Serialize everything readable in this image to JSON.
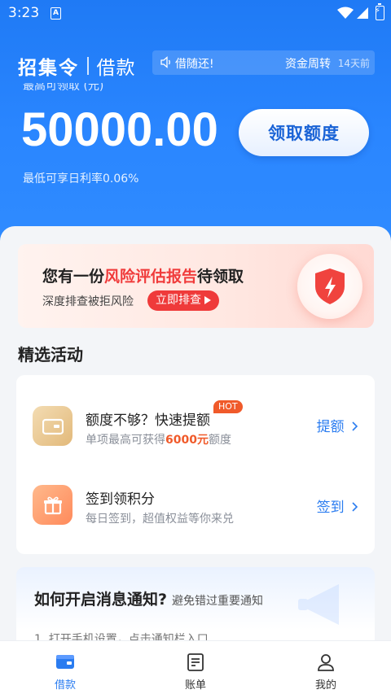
{
  "status_bar": {
    "time": "3:23",
    "app_indicator": "A"
  },
  "header": {
    "brand": "招集令",
    "section": "借款",
    "notice_left": "借随还!",
    "notice_mid": "资金周转",
    "notice_time": "14天前"
  },
  "loan": {
    "max_label": "最高可领取 (元)",
    "amount": "50000.00",
    "claim_button": "领取额度",
    "rate_text": "最低可享日利率0.06%"
  },
  "report_banner": {
    "title_prefix": "您有一份",
    "title_highlight": "风险评估报告",
    "title_suffix": "待领取",
    "subtitle": "深度排查被拒风险",
    "button": "立即排查"
  },
  "activities": {
    "title": "精选活动",
    "items": [
      {
        "name": "额度不够？快速提额",
        "badge": "HOT",
        "desc_prefix": "单项最高可获得",
        "desc_highlight": "6000元",
        "desc_suffix": "额度",
        "link": "提额",
        "icon": "wallet-card-icon"
      },
      {
        "name": "签到领积分",
        "desc": "每日签到，超值权益等你来兑",
        "link": "签到",
        "icon": "gift-icon"
      }
    ]
  },
  "notify_card": {
    "title": "如何开启消息通知?",
    "subtitle": "避免错过重要通知",
    "step": "1. 打开手机设置，点击通知栏入口"
  },
  "bottom_nav": {
    "items": [
      {
        "label": "借款",
        "active": true,
        "icon": "wallet-icon"
      },
      {
        "label": "账单",
        "active": false,
        "icon": "bill-icon"
      },
      {
        "label": "我的",
        "active": false,
        "icon": "user-icon"
      }
    ]
  },
  "colors": {
    "primary": "#2a86ff",
    "accent_red": "#ef3a3a",
    "link_blue": "#2a7cf0",
    "hot_orange": "#f05a2a"
  }
}
